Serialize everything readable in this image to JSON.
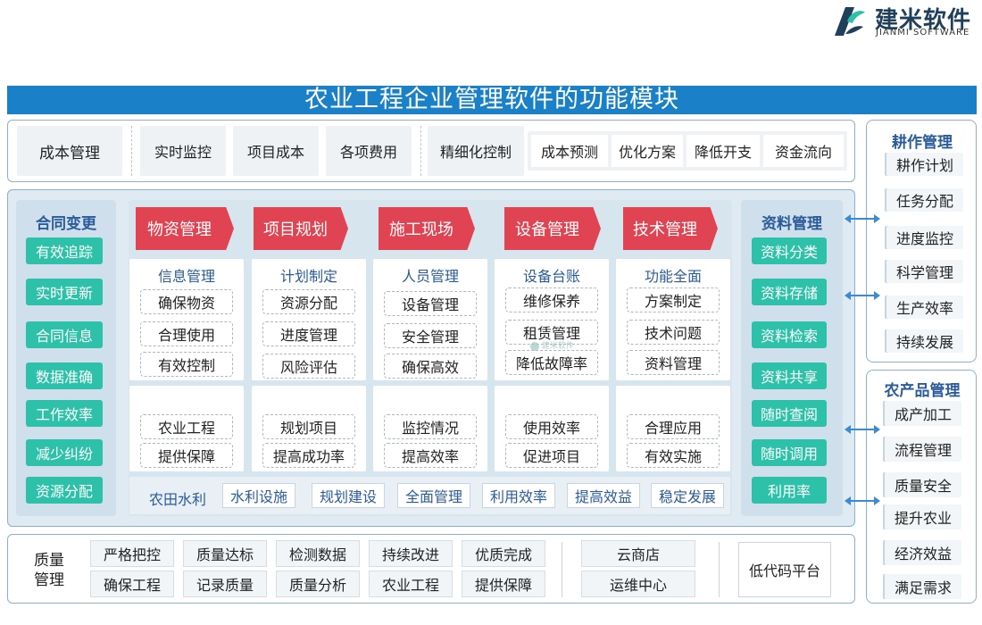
{
  "logo": {
    "cn": "建米软件",
    "en": "JIANMI SOFTWARE"
  },
  "title": "农业工程企业管理软件的功能模块",
  "cost": {
    "label": "成本管理",
    "items": [
      "实时监控",
      "项目成本",
      "各项费用"
    ],
    "refine": "精细化控制",
    "sub": [
      "成本预测",
      "优化方案",
      "降低开支",
      "资金流向"
    ]
  },
  "contract": {
    "title": "合同变更",
    "items": [
      "有效追踪",
      "实时更新",
      "合同信息",
      "数据准确",
      "工作效率",
      "减少纠纷",
      "资源分配"
    ]
  },
  "tabs": [
    "物资管理",
    "项目规划",
    "施工现场",
    "设备管理",
    "技术管理"
  ],
  "cards_top": [
    {
      "head": "信息管理",
      "items": [
        "确保物资",
        "合理使用",
        "有效控制"
      ]
    },
    {
      "head": "计划制定",
      "items": [
        "资源分配",
        "进度管理",
        "风险评估"
      ]
    },
    {
      "head": "人员管理",
      "items": [
        "设备管理",
        "安全管理",
        "确保高效"
      ]
    },
    {
      "head": "设备台账",
      "items": [
        "维修保养",
        "租赁管理",
        "降低故障率"
      ]
    },
    {
      "head": "功能全面",
      "items": [
        "方案制定",
        "技术问题",
        "资料管理"
      ]
    }
  ],
  "cards_bottom": [
    {
      "items": [
        "农业工程",
        "提供保障"
      ]
    },
    {
      "items": [
        "规划项目",
        "提高成功率"
      ]
    },
    {
      "items": [
        "监控情况",
        "提高效率"
      ]
    },
    {
      "items": [
        "使用效率",
        "促进项目"
      ]
    },
    {
      "items": [
        "合理应用",
        "有效实施"
      ]
    }
  ],
  "water": {
    "label": "农田水利",
    "items": [
      "水利设施",
      "规划建设",
      "全面管理",
      "利用效率",
      "提高效益",
      "稳定发展"
    ]
  },
  "data_mgmt": {
    "title": "资料管理",
    "items": [
      "资料分类",
      "资料存储",
      "资料检索",
      "资料共享",
      "随时查阅",
      "随时调用",
      "利用率"
    ]
  },
  "farming": {
    "title": "耕作管理",
    "items": [
      "耕作计划",
      "任务分配",
      "进度监控",
      "科学管理",
      "生产效率",
      "持续发展"
    ]
  },
  "products": {
    "title": "农产品管理",
    "items": [
      "成产加工",
      "流程管理",
      "质量安全",
      "提升农业",
      "经济效益",
      "满足需求"
    ]
  },
  "quality": {
    "label_line1": "质量",
    "label_line2": "管理",
    "row1": [
      "严格把控",
      "质量达标",
      "检测数据",
      "持续改进",
      "优质完成"
    ],
    "row2": [
      "确保工程",
      "记录质量",
      "质量分析",
      "农业工程",
      "提供保障"
    ],
    "cloud": [
      "云商店",
      "运维中心"
    ],
    "lowcode": "低代码平台"
  },
  "watermark": "建米软件",
  "colors": {
    "title_bg": "#1a80c8",
    "tab_red": "#e04452",
    "teal": "#2ec1a9",
    "heading_blue": "#2a5b9a",
    "panel_bg": "#dfeaf3"
  }
}
